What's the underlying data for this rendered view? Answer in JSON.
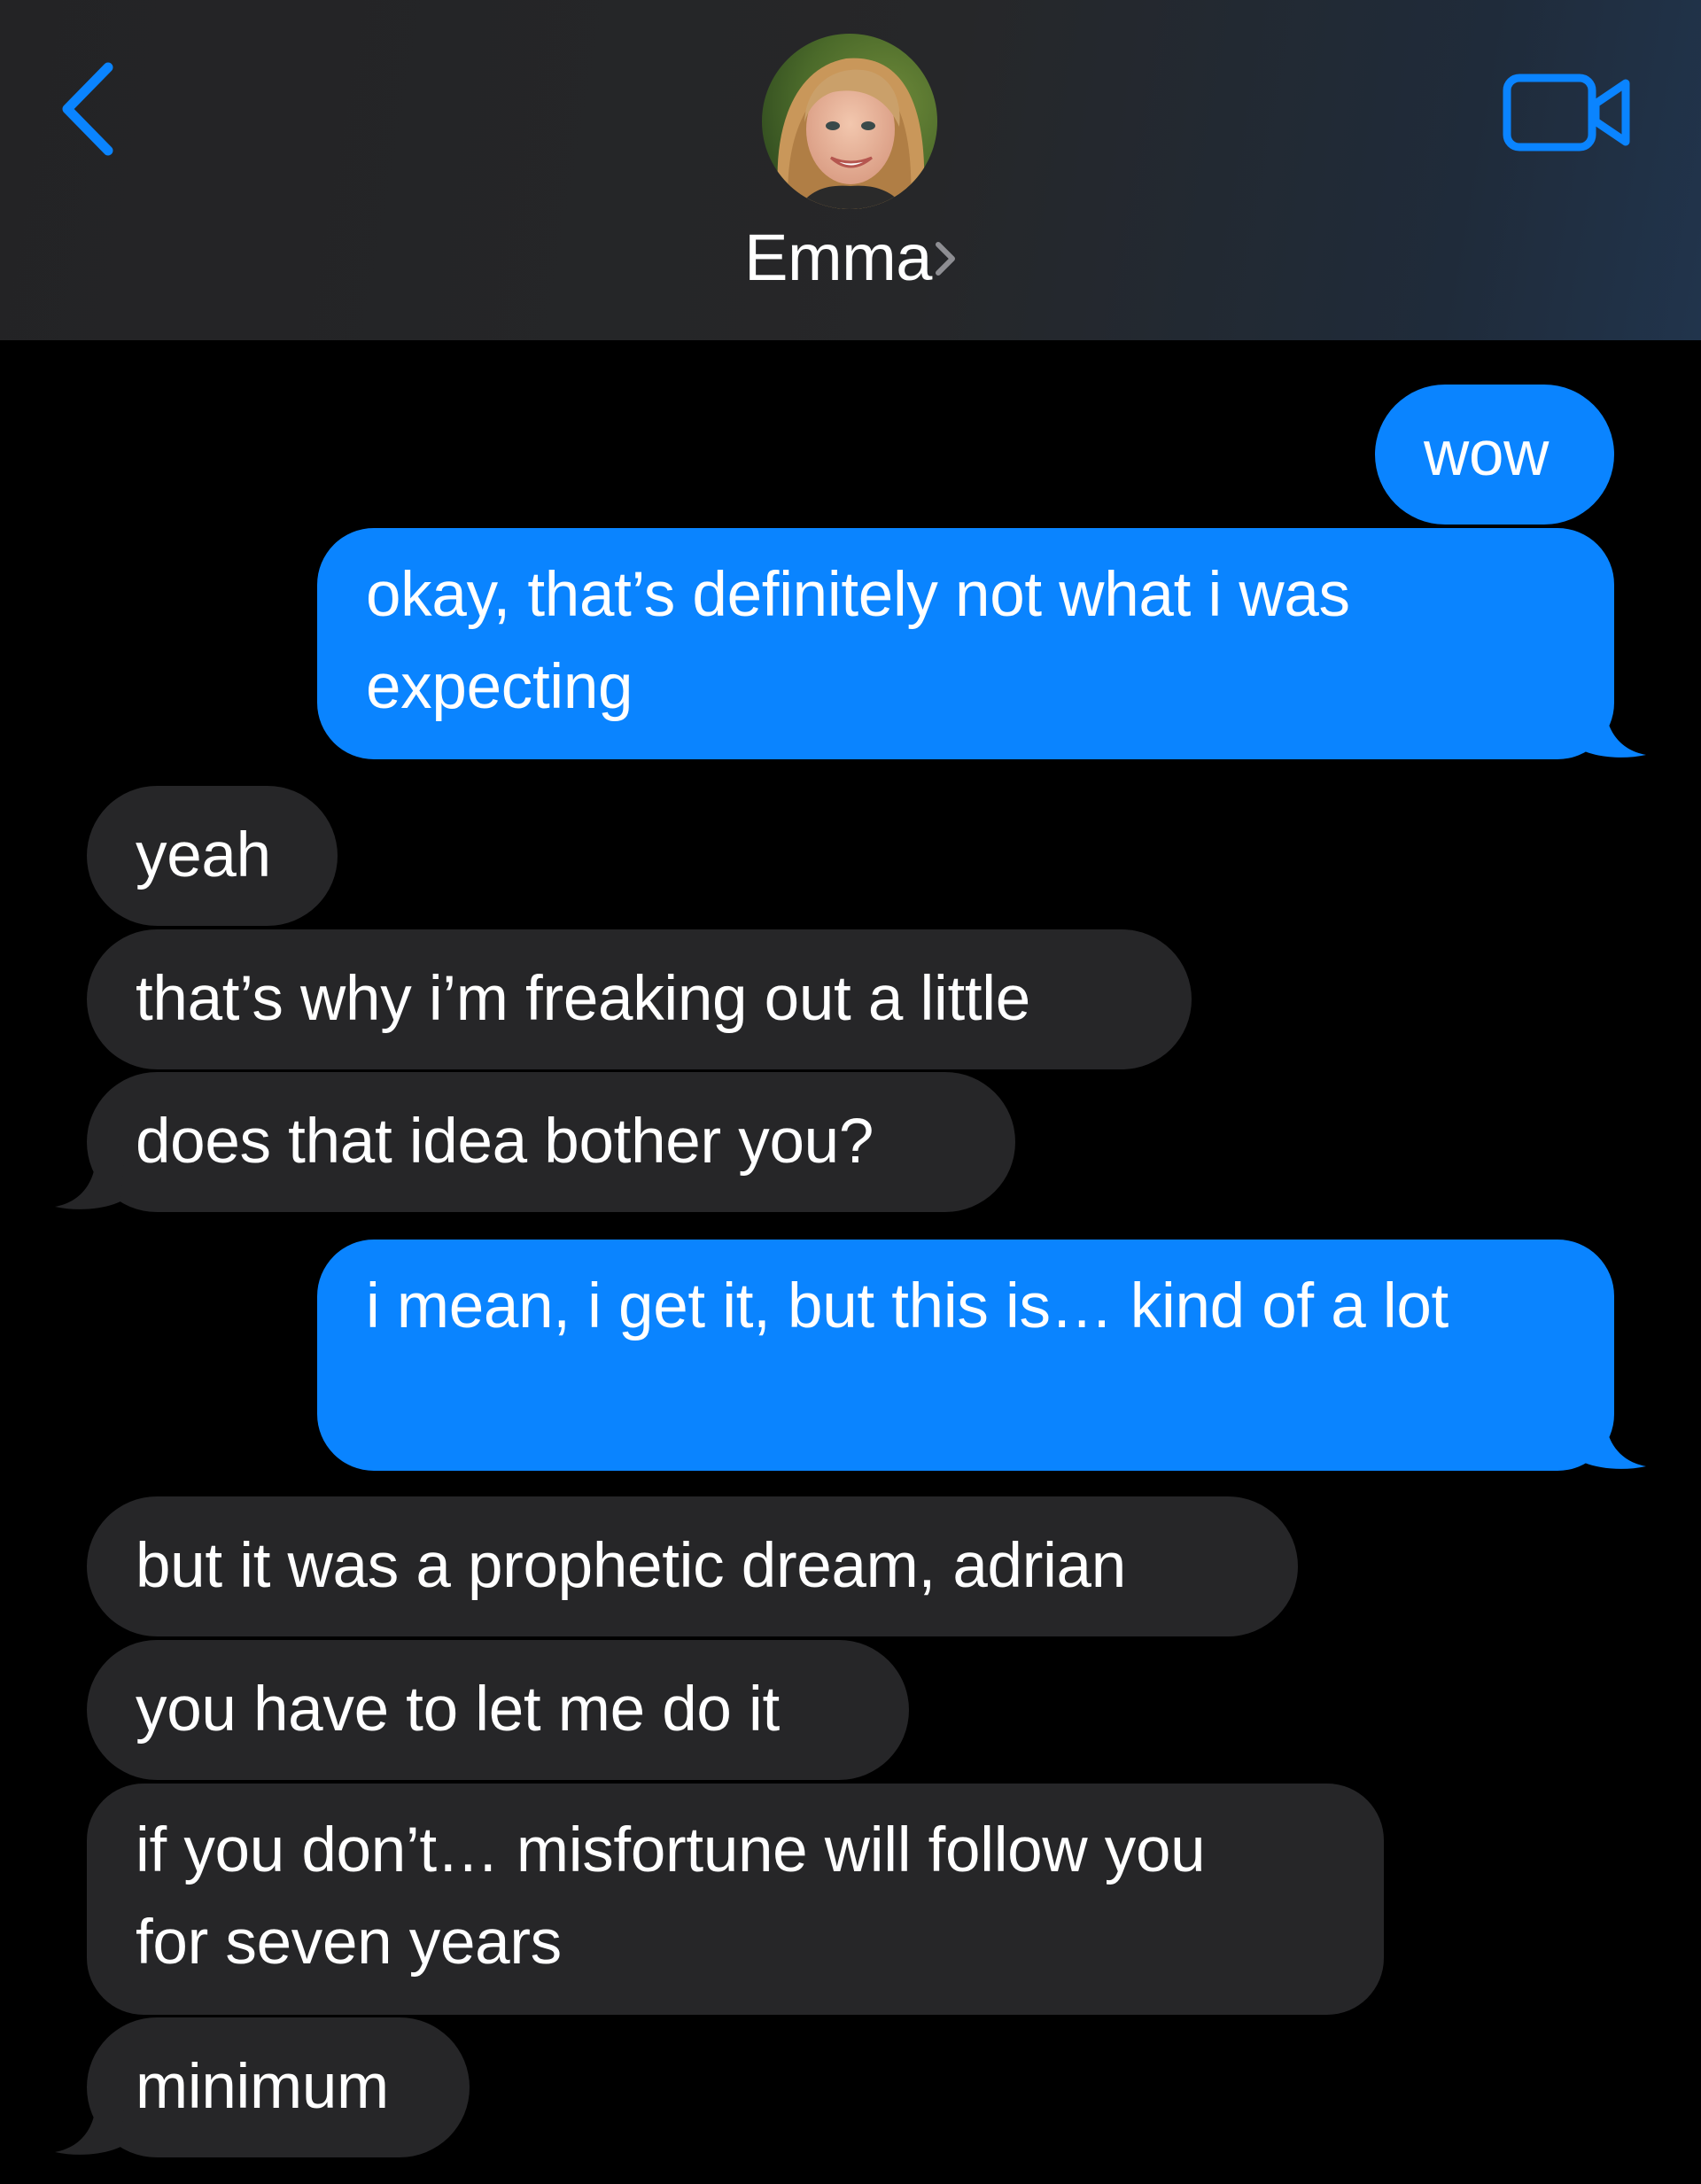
{
  "header": {
    "contact_name": "Emma",
    "back_icon": "chevron-left-icon",
    "video_icon": "video-camera-icon",
    "disclosure_icon": "chevron-right-icon"
  },
  "colors": {
    "outgoing_bubble": "#0a84ff",
    "incoming_bubble": "#262628",
    "accent": "#0a84ff",
    "background": "#000000"
  },
  "messages": [
    {
      "direction": "outgoing",
      "text": "wow"
    },
    {
      "direction": "outgoing",
      "text": "okay, that’s definitely not what i was expecting"
    },
    {
      "direction": "incoming",
      "text": "yeah"
    },
    {
      "direction": "incoming",
      "text": "that’s why i’m freaking out a little"
    },
    {
      "direction": "incoming",
      "text": "does that idea bother you?"
    },
    {
      "direction": "outgoing",
      "text": "i mean, i get it, but this is… kind of a lot"
    },
    {
      "direction": "incoming",
      "text": "but it was a prophetic dream, adrian"
    },
    {
      "direction": "incoming",
      "text": "you have to let me do it"
    },
    {
      "direction": "incoming",
      "text": "if you don’t… misfortune will follow you for seven years"
    },
    {
      "direction": "incoming",
      "text": "minimum"
    }
  ]
}
